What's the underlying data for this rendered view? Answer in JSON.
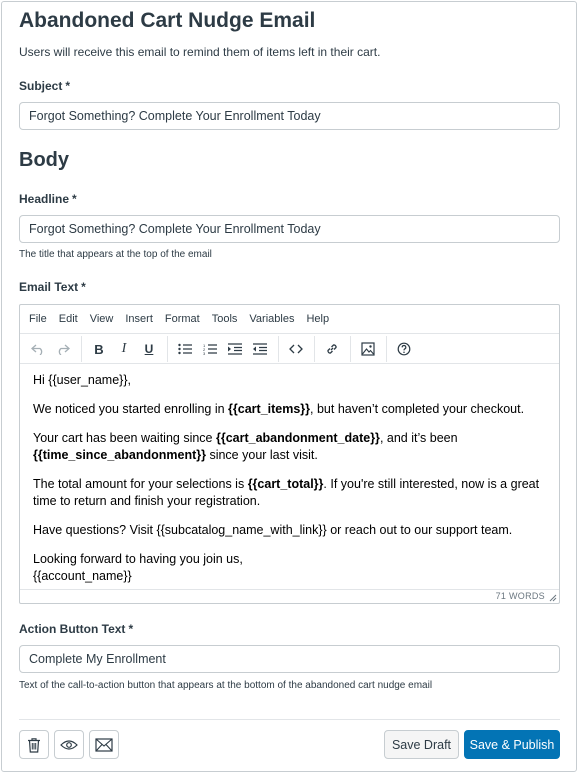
{
  "page": {
    "title": "Abandoned Cart Nudge Email",
    "description": "Users will receive this email to remind them of items left in their cart."
  },
  "subject": {
    "label": "Subject",
    "required_mark": "*",
    "value": "Forgot Something? Complete Your Enrollment Today"
  },
  "body_section": {
    "title": "Body"
  },
  "headline": {
    "label": "Headline",
    "required_mark": "*",
    "value": "Forgot Something? Complete Your Enrollment Today",
    "hint": "The title that appears at the top of the email"
  },
  "email_text": {
    "label": "Email Text",
    "required_mark": "*",
    "menubar": [
      "File",
      "Edit",
      "View",
      "Insert",
      "Format",
      "Tools",
      "Variables",
      "Help"
    ],
    "toolbar_icons": [
      "undo-icon",
      "redo-icon",
      "bold-icon",
      "italic-icon",
      "underline-icon",
      "bullet-list-icon",
      "numbered-list-icon",
      "indent-icon",
      "outdent-icon",
      "code-icon",
      "link-icon",
      "image-icon",
      "help-icon"
    ],
    "content": {
      "greeting": "Hi {{user_name}},",
      "p1_a": "We noticed you started enrolling in ",
      "p1_b": "{{cart_items}}",
      "p1_c": ", but haven’t completed your checkout.",
      "p2_a": "Your cart has been waiting since ",
      "p2_b": "{{cart_abandonment_date}}",
      "p2_c": ", and it’s been",
      "p2_d": "{{time_since_abandonment}}",
      "p2_e": " since your last visit.",
      "p3_a": "The total amount for your selections is ",
      "p3_b": "{{cart_total}}",
      "p3_c": ". If you're still interested, now is a great time to return and finish your registration.",
      "p4": "Have questions? Visit {{subcatalog_name_with_link}} or reach out to our support team.",
      "p5_a": "Looking forward to having you join us,",
      "p5_b": "{{account_name}}"
    },
    "word_count": "71 WORDS"
  },
  "action_button": {
    "label": "Action Button Text",
    "required_mark": "*",
    "value": "Complete My Enrollment",
    "hint": "Text of the call-to-action button that appears at the bottom of the abandoned cart nudge email"
  },
  "footer": {
    "icons": [
      "trash-icon",
      "eye-icon",
      "envelope-icon"
    ],
    "save_draft": "Save Draft",
    "save_publish": "Save & Publish"
  },
  "colors": {
    "primary": "#0374b5",
    "text": "#2d3b45",
    "border": "#c7cdd1"
  }
}
